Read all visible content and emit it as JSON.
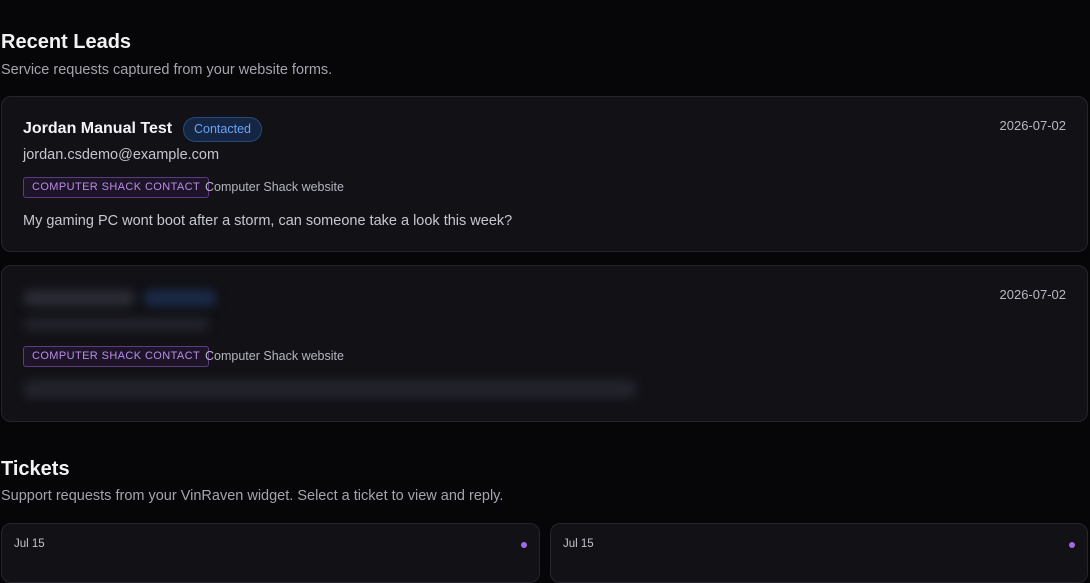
{
  "leads_section": {
    "title": "Recent Leads",
    "subtitle": "Service requests captured from your website forms."
  },
  "leads": [
    {
      "name": "Jordan Manual Test",
      "status": "Contacted",
      "date": "2026-07-02",
      "email": "jordan.csdemo@example.com",
      "source_tag": "COMPUTER SHACK CONTACT",
      "source_site": "Computer Shack website",
      "message": "My gaming PC wont boot after a storm, can someone take a look this week?"
    },
    {
      "date": "2026-07-02",
      "source_tag": "COMPUTER SHACK CONTACT",
      "source_site": "Computer Shack website"
    }
  ],
  "tickets_section": {
    "title": "Tickets",
    "subtitle": "Support requests from your VinRaven widget. Select a ticket to view and reply."
  },
  "tickets": [
    {
      "date": "Jul 15"
    },
    {
      "date": "Jul 15"
    }
  ],
  "colors": {
    "background": "#060608",
    "card": "#111116",
    "status_contacted": "#6aa3f2",
    "source_tag": "#b98ce8",
    "unread_dot": "#a06ce4"
  }
}
